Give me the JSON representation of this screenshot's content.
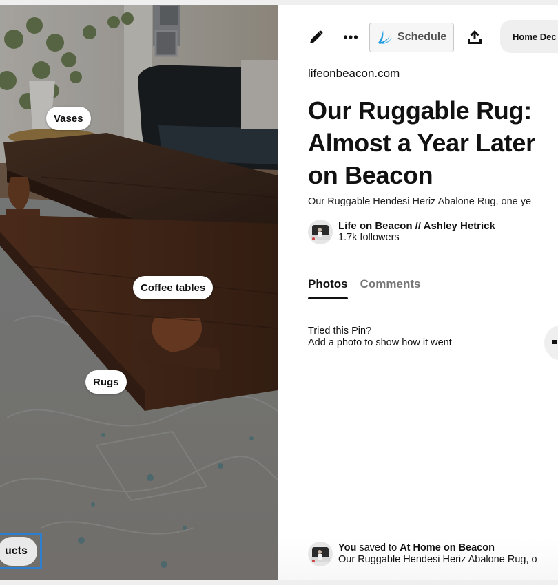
{
  "image": {
    "alt": "Living room with dark wood coffee table, leather sofa, vase of greenery, and blue-gray vintage rug",
    "tags": [
      {
        "label": "Vases"
      },
      {
        "label": "Coffee tables"
      },
      {
        "label": "Rugs"
      }
    ],
    "shop_button": {
      "label": "ucts"
    }
  },
  "toolbar": {
    "edit_icon": "pencil-icon",
    "more_icon": "ellipsis-icon",
    "schedule_label": "Schedule",
    "share_icon": "share-upload-icon",
    "board_label": "Home Dec"
  },
  "pin": {
    "source": "lifeonbeacon.com",
    "title_lines": [
      "Our Ruggable Rug:",
      "Almost a Year Later",
      "on Beacon"
    ],
    "description": "Our Ruggable Hendesi Heriz Abalone Rug, one ye"
  },
  "creator": {
    "name": "Life on Beacon // Ashley Hetrick",
    "followers": "1.7k followers"
  },
  "tabs": [
    {
      "label": "Photos",
      "active": true
    },
    {
      "label": "Comments",
      "active": false
    }
  ],
  "tried": {
    "line1": "Tried this Pin?",
    "line2": "Add a photo to show how it went"
  },
  "activity": {
    "actor": "You",
    "verb": " saved to ",
    "board": "At Home on Beacon",
    "snippet": "Our Ruggable Hendesi Heriz Abalone Rug, o"
  },
  "colors": {
    "accent_blue": "#2f7fd1",
    "schedule_logo": "#1e9be0",
    "text": "#111111",
    "muted_tab": "#767676",
    "chip_bg": "#efefef"
  }
}
